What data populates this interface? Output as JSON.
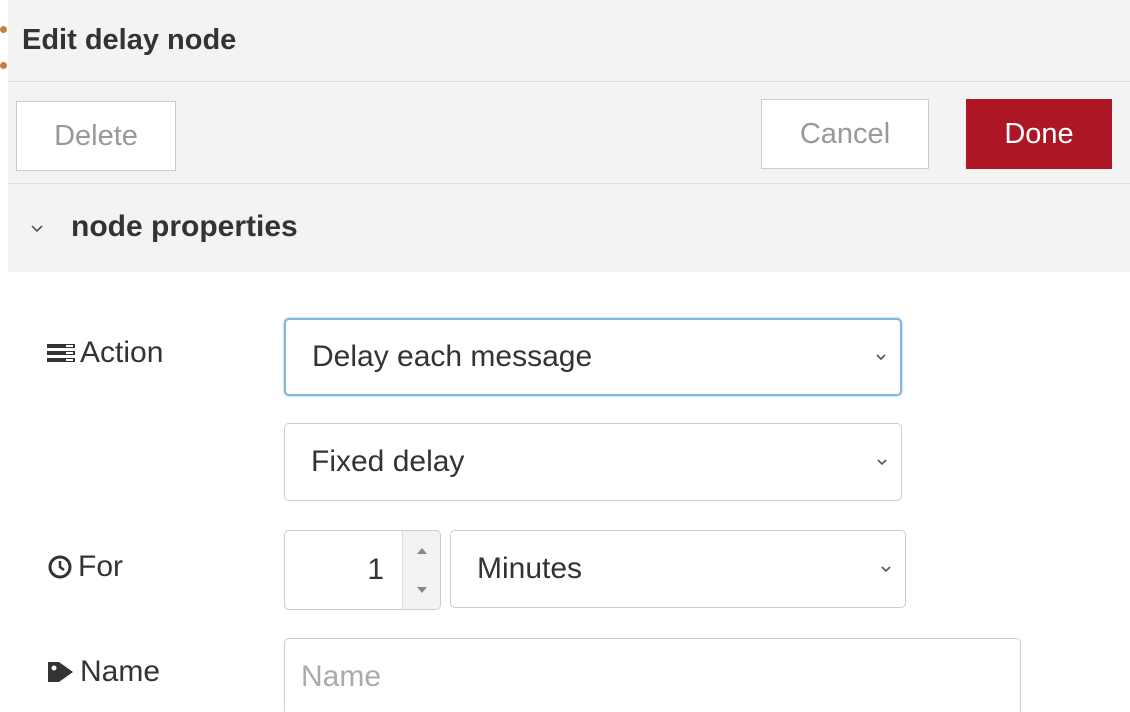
{
  "tray": {
    "title": "Edit delay node"
  },
  "toolbar": {
    "delete_label": "Delete",
    "cancel_label": "Cancel",
    "done_label": "Done"
  },
  "section": {
    "title": "node properties"
  },
  "form": {
    "action": {
      "label": "Action",
      "icon": "list-icon",
      "selected": "Delay each message"
    },
    "delay_type": {
      "selected": "Fixed delay"
    },
    "for": {
      "label": "For",
      "icon": "clock-icon",
      "value": "1",
      "unit_selected": "Minutes"
    },
    "name": {
      "label": "Name",
      "icon": "tag-icon",
      "value": "",
      "placeholder": "Name"
    }
  },
  "colors": {
    "accent_done": "#ad1625",
    "focus_border": "#85b7d9",
    "panel_bg": "#f3f3f3"
  }
}
